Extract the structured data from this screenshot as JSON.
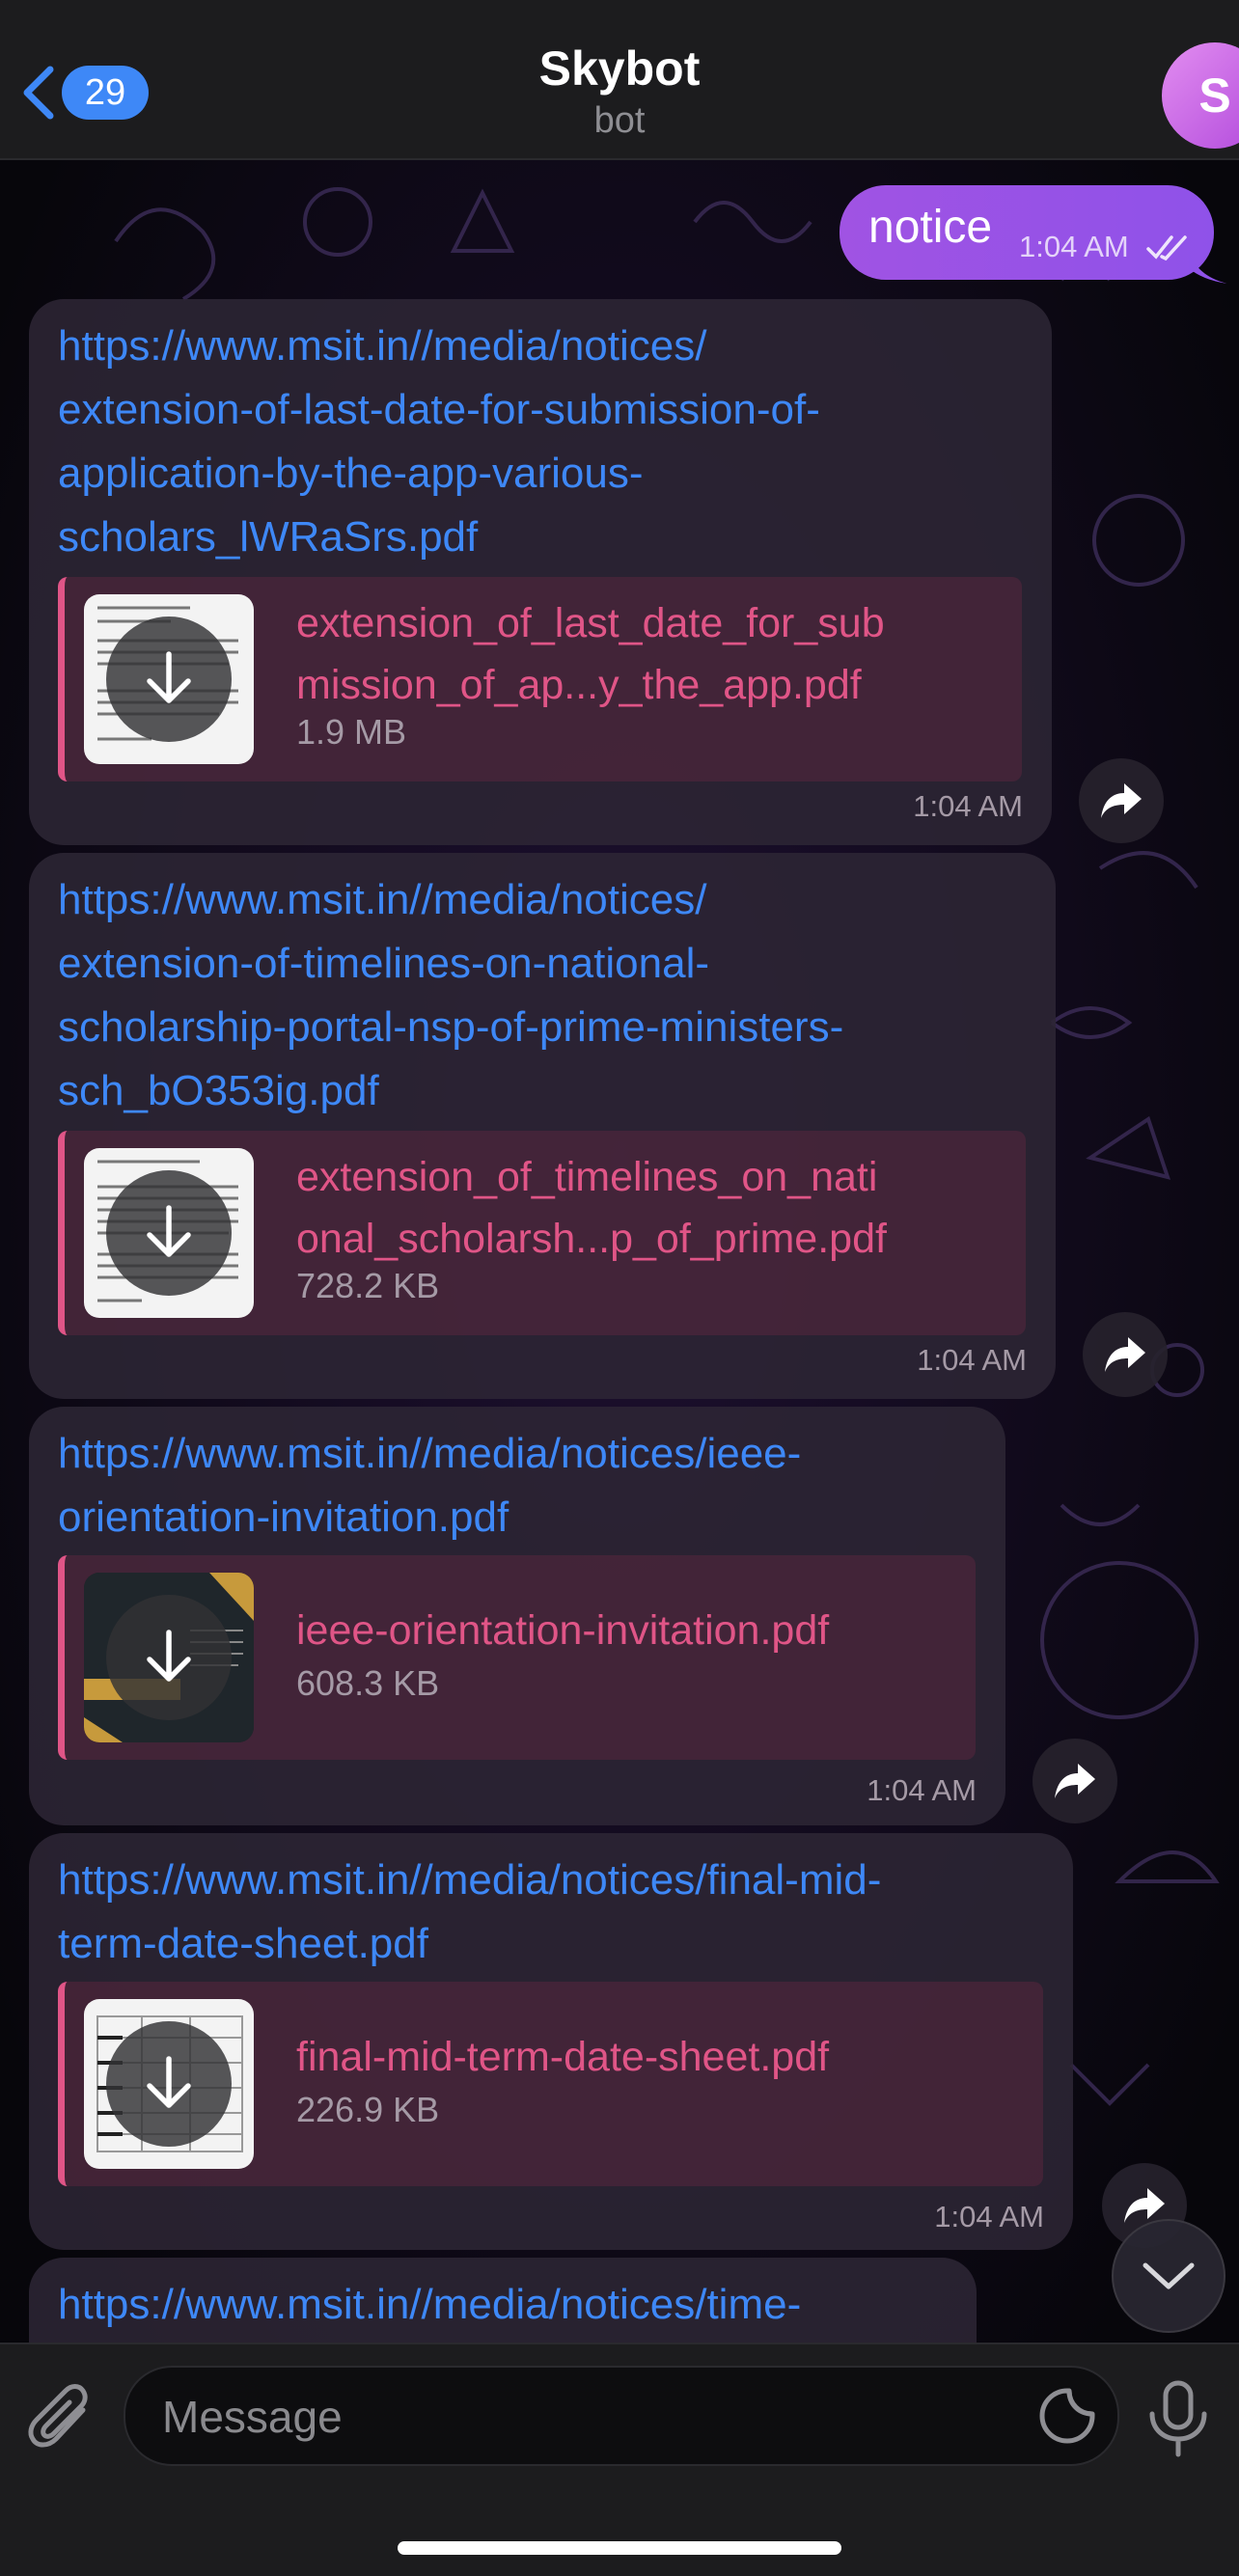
{
  "header": {
    "unread_count": "29",
    "title": "Skybot",
    "subtitle": "bot",
    "avatar_letter": "S"
  },
  "outgoing": {
    "text": "notice",
    "time": "1:04 AM"
  },
  "messages": [
    {
      "link": "https://www.msit.in//media/notices/\nextension-of-last-date-for-submission-of-\napplication-by-the-app-various-\nscholars_lWRaSrs.pdf",
      "file_name": "extension_of_last_date_for_sub\nmission_of_ap...y_the_app.pdf",
      "file_size": "1.9 MB",
      "time": "1:04 AM",
      "thumb": "document"
    },
    {
      "link": "https://www.msit.in//media/notices/\nextension-of-timelines-on-national-\nscholarship-portal-nsp-of-prime-ministers-\nsch_bO353ig.pdf",
      "file_name": "extension_of_timelines_on_nati\nonal_scholarsh...p_of_prime.pdf",
      "file_size": "728.2 KB",
      "time": "1:04 AM",
      "thumb": "document"
    },
    {
      "link": "https://www.msit.in//media/notices/ieee-\norientation-invitation.pdf",
      "file_name": "ieee-orientation-invitation.pdf",
      "file_size": "608.3 KB",
      "time": "1:04 AM",
      "thumb": "invitation"
    },
    {
      "link": "https://www.msit.in//media/notices/final-mid-\nterm-date-sheet.pdf",
      "file_name": "final-mid-term-date-sheet.pdf",
      "file_size": "226.9 KB",
      "time": "1:04 AM",
      "thumb": "table"
    },
    {
      "link": "https://www.msit.in//media/notices/time-\n"
    }
  ],
  "input": {
    "placeholder": "Message"
  },
  "icons": {
    "back": "chevron-left-icon",
    "read_receipt": "double-check-icon",
    "download": "download-arrow-icon",
    "forward": "forward-icon",
    "scroll_down": "chevron-down-icon",
    "attach": "paperclip-icon",
    "sticker": "sticker-icon",
    "mic": "microphone-icon"
  },
  "colors": {
    "link": "#3e88f7",
    "file_accent": "#e05587",
    "outgoing_bubble": "#9d53e5",
    "badge": "#3e88f7"
  }
}
